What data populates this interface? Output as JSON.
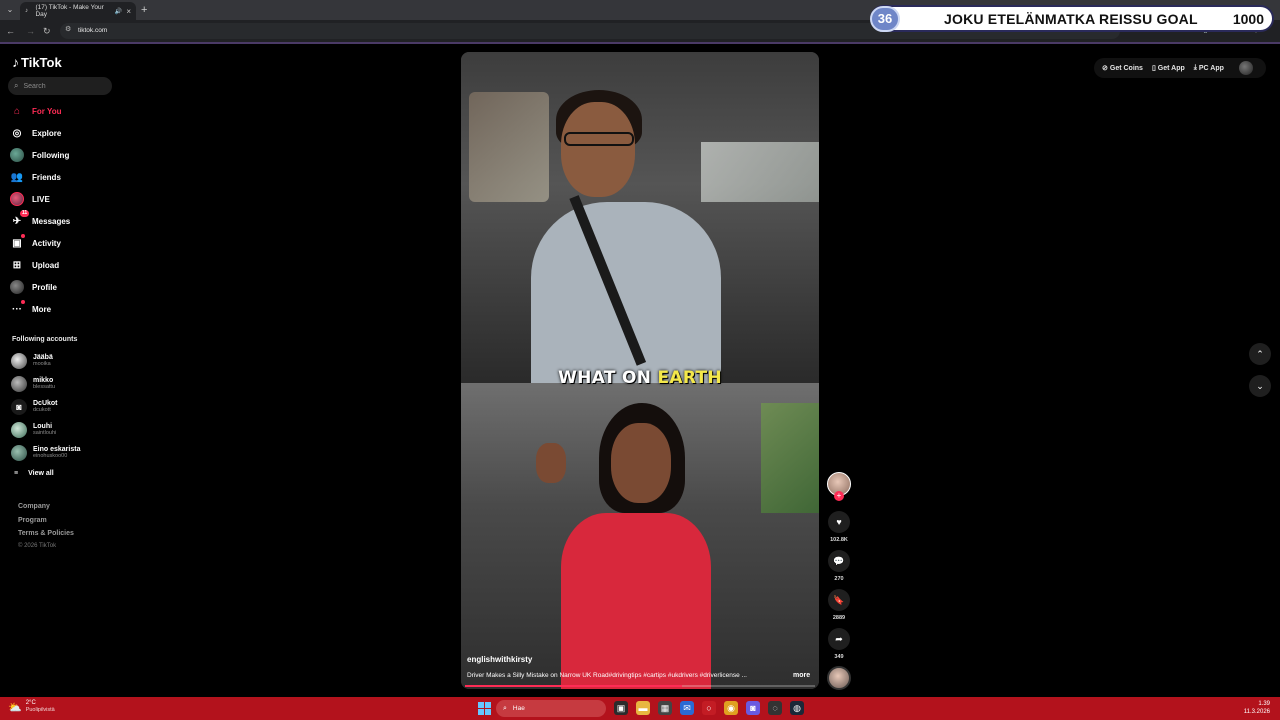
{
  "browser": {
    "tab_title": "(17) TikTok - Make Your Day",
    "url": "tiktok.com",
    "new_tab": "+",
    "tab_close": "×",
    "dropdown": "⌄"
  },
  "goal": {
    "count_left": "36",
    "title": "JOKU ETELÄNMATKA REISSU GOAL",
    "count_right": "1000"
  },
  "tiktok": {
    "logo": "TikTok",
    "search_placeholder": "Search",
    "nav": {
      "for_you": "For You",
      "explore": "Explore",
      "following": "Following",
      "friends": "Friends",
      "live": "LIVE",
      "messages": "Messages",
      "messages_badge": "11",
      "activity": "Activity",
      "upload": "Upload",
      "profile": "Profile",
      "more": "More"
    },
    "following_accounts_title": "Following accounts",
    "following_accounts": [
      {
        "name": "Jääbä",
        "handle": "mooika"
      },
      {
        "name": "mikko",
        "handle": "blessattu"
      },
      {
        "name": "DcUkot",
        "handle": "dcukott"
      },
      {
        "name": "Louhi",
        "handle": "saintlouhi"
      },
      {
        "name": "Eino eskarista",
        "handle": "einohuskoo00"
      }
    ],
    "view_all": "View all",
    "footer": {
      "company": "Company",
      "program": "Program",
      "terms": "Terms & Policies",
      "copyright": "© 2026 TikTok"
    },
    "top_actions": {
      "get_coins": "Get Coins",
      "get_app": "Get App",
      "pc_app": "PC App"
    },
    "video": {
      "caption_word1": "WHAT ON",
      "caption_word2": "EARTH",
      "author": "englishwithkirsty",
      "description": "Driver Makes a Silly Mistake on Narrow UK Road#drivingtips #cartips #ukdrivers #driverlicense ...",
      "more": "more",
      "progress": 0.62
    },
    "rail": {
      "likes": "102.8K",
      "comments": "270",
      "saves": "2889",
      "shares": "349"
    }
  },
  "taskbar": {
    "temp": "2°C",
    "weather": "Puolipilvistä",
    "search": "Hae",
    "time": "1.39",
    "date": "11.3.2026"
  },
  "colors": {
    "accent": "#fe2c55",
    "taskbar": "#b3121c",
    "caption_highlight": "#f4e84a"
  }
}
